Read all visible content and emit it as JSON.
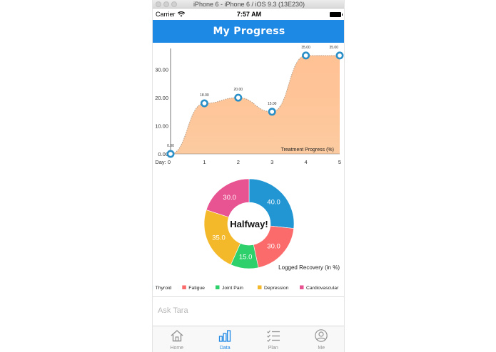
{
  "window": {
    "title": "iPhone 6 - iPhone 6 / iOS 9.3 (13E230)"
  },
  "status": {
    "carrier": "Carrier",
    "time": "7:57 AM"
  },
  "nav": {
    "title": "My Progress"
  },
  "colors": {
    "nav_blue": "#1e88e5",
    "area_fill": "#fcc89b",
    "line_dots": "#a09080",
    "marker": "#2b8fc7"
  },
  "chart_data": [
    {
      "type": "area",
      "x_prefix": "Day: ",
      "x": [
        0,
        1,
        2,
        3,
        4,
        5
      ],
      "x_tick_labels": [
        "0",
        "1",
        "2",
        "3",
        "4",
        "5"
      ],
      "y": [
        0,
        18,
        20,
        15,
        35,
        35
      ],
      "point_labels": [
        "0.00",
        "18.00",
        "20.00",
        "15.00",
        "35.00",
        "35.00"
      ],
      "y_ticks": [
        0,
        10,
        20,
        30
      ],
      "y_tick_labels": [
        "0.00",
        "10.00",
        "20.00",
        "30.00"
      ],
      "ylim": [
        0,
        37
      ],
      "series_label": "Treatment Progress (%)",
      "grid": false
    },
    {
      "type": "pie",
      "center_text": "Halfway!",
      "caption": "Logged Recovery (in %)",
      "slices": [
        {
          "name": "Thyroid",
          "value": 40,
          "label": "40.0",
          "color": "#2196d3"
        },
        {
          "name": "Fatigue",
          "value": 30,
          "label": "30.0",
          "color": "#fb6b6b"
        },
        {
          "name": "Joint Pain",
          "value": 15,
          "label": "15.0",
          "color": "#2ed06b"
        },
        {
          "name": "Depression",
          "value": 35,
          "label": "35.0",
          "color": "#f4b92b"
        },
        {
          "name": "Cardiovascular",
          "value": 30,
          "label": "30.0",
          "color": "#e85391"
        }
      ],
      "legend_position": "bottom"
    }
  ],
  "input": {
    "placeholder": "Ask Tara"
  },
  "tabs": [
    {
      "label": "Home",
      "icon": "home-icon",
      "active": false
    },
    {
      "label": "Data",
      "icon": "bar-chart-icon",
      "active": true
    },
    {
      "label": "Plan",
      "icon": "checklist-icon",
      "active": false
    },
    {
      "label": "Me",
      "icon": "person-icon",
      "active": false
    }
  ]
}
